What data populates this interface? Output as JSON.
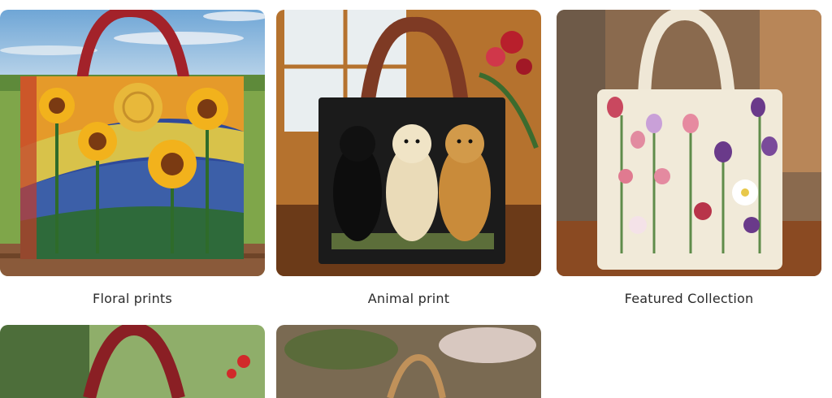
{
  "collections": [
    {
      "label": "Floral prints",
      "image": "sunflower quilted tote bag"
    },
    {
      "label": "Animal print",
      "image": "labrador dogs quilted tote bag"
    },
    {
      "label": "Featured Collection",
      "image": "embroidered tulip tote bag"
    },
    {
      "label": "",
      "image": "red paisley tote bag"
    },
    {
      "label": "",
      "image": "outdoor tote bag"
    }
  ]
}
